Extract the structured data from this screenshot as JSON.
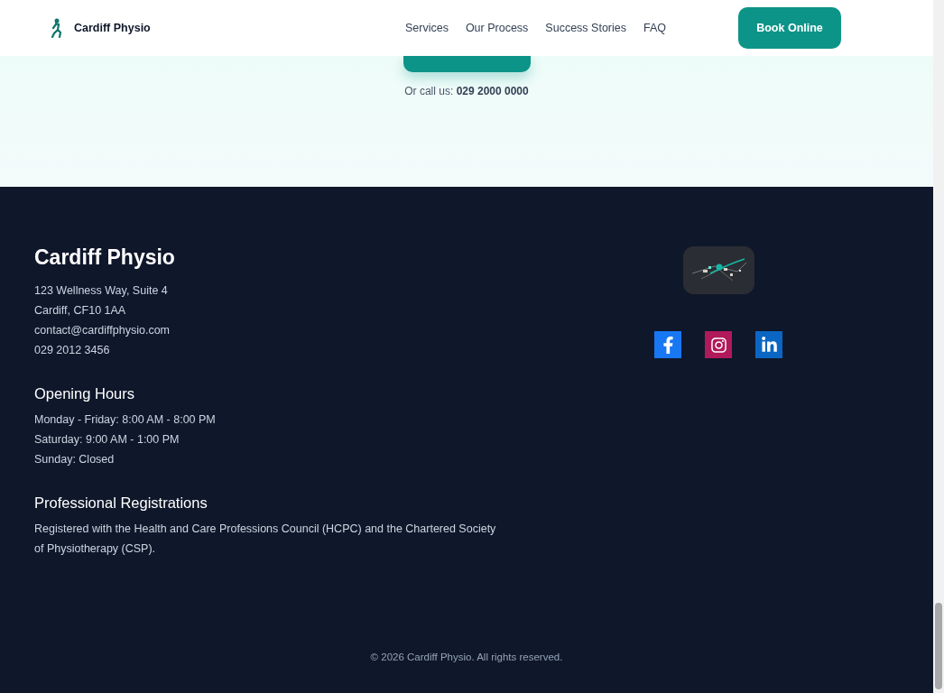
{
  "header": {
    "brand": "Cardiff Physio",
    "nav": [
      "Services",
      "Our Process",
      "Success Stories",
      "FAQ"
    ],
    "button": "Book Online"
  },
  "hero": {
    "call_text": "Or call us: **029 2000 0000**"
  },
  "footer": {
    "brand": "Cardiff Physio",
    "contact_lines": [
      "123 Wellness Way, Suite 4",
      "Cardiff, CF10 1AA",
      "contact@cardiffphysio.com",
      "029 2012 3456"
    ],
    "opening_hours": {
      "title": "Opening Hours",
      "lines": [
        "Monday - Friday: 8:00 AM - 8:00 PM",
        "Saturday: 9:00 AM - 1:00 PM",
        "Sunday: Closed"
      ]
    },
    "registrations": {
      "title": "Professional Registrations",
      "text": "Registered with the Health and Care Professions Council (HCPC) and the Chartered Society of Physiotherapy (CSP)."
    },
    "social": [
      {
        "kind": "facebook"
      },
      {
        "kind": "instagram"
      },
      {
        "kind": "linkedin"
      }
    ],
    "copyright": "© 2026 Cardiff Physio. All rights reserved."
  }
}
